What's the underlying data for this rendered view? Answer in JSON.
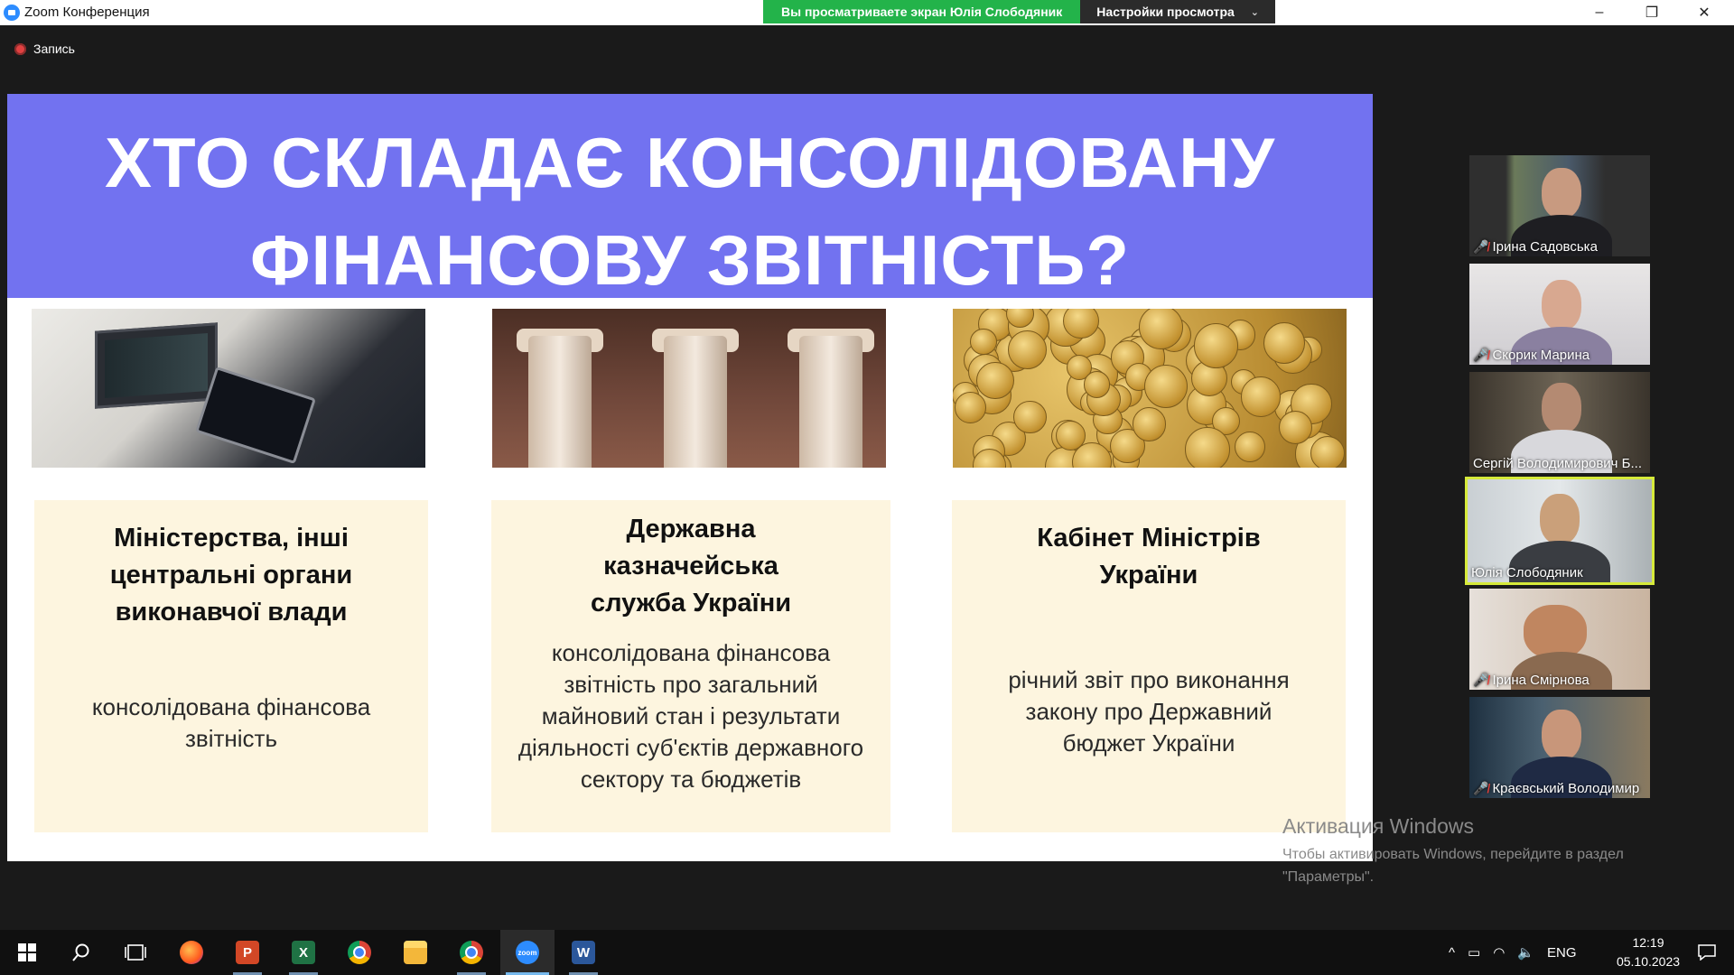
{
  "window": {
    "title": "Zoom Конференция",
    "share_banner": "Вы просматриваете экран Юлія Слободяник",
    "view_settings": "Настройки просмотра",
    "minimize": "–",
    "maximize": "❐",
    "close": "✕"
  },
  "recording": {
    "label": "Запись"
  },
  "slide": {
    "title_line1": "ХТО СКЛАДАЄ КОНСОЛІДОВАНУ",
    "title_line2": "ФІНАНСОВУ ЗВІТНІСТЬ?",
    "cards": [
      {
        "title": [
          "Міністерства, інші",
          "центральні органи",
          "виконавчої влади"
        ],
        "body": [
          "консолідована фінансова",
          "звітність"
        ]
      },
      {
        "title": [
          "Державна",
          "казначейська",
          "служба України"
        ],
        "body": [
          "консолідована фінансова",
          "звітність про загальний",
          "майновий стан і результати",
          "діяльності суб'єктів державного",
          "сектору та бюджетів"
        ]
      },
      {
        "title": [
          "Кабінет Міністрів",
          "України"
        ],
        "body": [
          "річний звіт про виконання",
          "закону про Державний",
          "бюджет України"
        ]
      }
    ]
  },
  "participants": [
    {
      "name": "Ірина Садовська",
      "muted": true
    },
    {
      "name": "Скорик Марина",
      "muted": true
    },
    {
      "name": "Сергій Володимирович Б...",
      "muted": false
    },
    {
      "name": "Юлія Слободяник",
      "muted": false,
      "active": true
    },
    {
      "name": "Ірина Смірнова",
      "muted": true
    },
    {
      "name": "Краєвський Володимир",
      "muted": true
    }
  ],
  "activation": {
    "title": "Активация Windows",
    "line1": "Чтобы активировать Windows, перейдите в раздел",
    "line2": "\"Параметры\"."
  },
  "taskbar": {
    "lang": "ENG",
    "time": "12:19",
    "date": "05.10.2023",
    "apps": [
      "start",
      "search",
      "task-view",
      "firefox",
      "powerpoint",
      "excel",
      "chrome",
      "file-explorer",
      "chrome-profile",
      "zoom",
      "word"
    ]
  },
  "colors": {
    "slide_header": "#7272f0",
    "card_bg": "#fdf5df",
    "share_green": "#23b34a",
    "active_speaker_border": "#d6ea3a"
  }
}
